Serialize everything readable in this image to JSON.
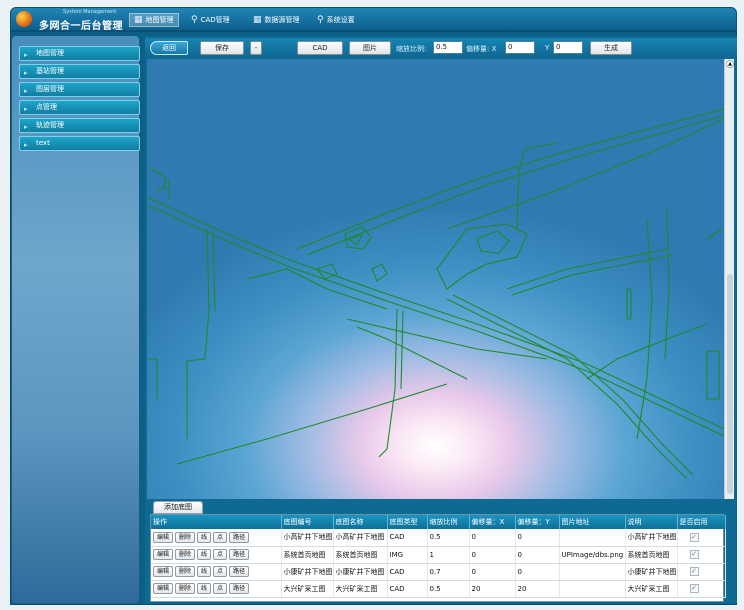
{
  "header": {
    "brand_sub": "System Management",
    "brand": "多网合一后台管理",
    "nav": [
      {
        "label": "地图管理",
        "icon": "grid-icon",
        "active": true
      },
      {
        "label": "CAD管理",
        "icon": "search-icon"
      },
      {
        "label": "数据源管理",
        "icon": "grid-icon"
      },
      {
        "label": "系统设置",
        "icon": "search-icon"
      }
    ]
  },
  "sidebar": {
    "items": [
      {
        "label": "地图管理"
      },
      {
        "label": "基站管理"
      },
      {
        "label": "图层管理"
      },
      {
        "label": "点管理"
      },
      {
        "label": "轨迹管理"
      },
      {
        "label": "text"
      }
    ]
  },
  "toolbar": {
    "back_label": "返回",
    "save_label": "保存",
    "minus_label": "-",
    "cad_label": "CAD",
    "image_label": "图片",
    "scale_label": "缩放比例:",
    "scale_value": "0.5",
    "offset_x_label": "偏移量: X",
    "offset_x_value": "0",
    "offset_y_label": "Y",
    "offset_y_value": "0",
    "generate_label": "生成"
  },
  "table": {
    "add_tab": "添加底图",
    "headers": [
      "操作",
      "底图编号",
      "底图名称",
      "底图类型",
      "缩放比例",
      "偏移量：X",
      "偏移量：Y",
      "图片地址",
      "说明",
      "是否启用"
    ],
    "actions": [
      "编辑",
      "删除",
      "线",
      "点",
      "路径"
    ],
    "rows": [
      {
        "code": "小高矿井下地图",
        "name": "小高矿井下地图",
        "type": "CAD",
        "scale": "0.5",
        "x": "0",
        "y": "0",
        "addr": "",
        "desc": "小高矿井下地图",
        "enabled": "✓"
      },
      {
        "code": "系统首页地图",
        "name": "系统首页地图",
        "type": "IMG",
        "scale": "1",
        "x": "0",
        "y": "0",
        "addr": "UPImage/dbs.png",
        "desc": "系统首页地图",
        "enabled": "✓"
      },
      {
        "code": "小康矿井下地图",
        "name": "小康矿井下地图",
        "type": "CAD",
        "scale": "0.7",
        "x": "0",
        "y": "0",
        "addr": "",
        "desc": "小康矿井下地图",
        "enabled": "✓"
      },
      {
        "code": "大兴矿采工图",
        "name": "大兴矿采工图",
        "type": "CAD",
        "scale": "0.5",
        "x": "20",
        "y": "20",
        "addr": "",
        "desc": "大兴矿采工图",
        "enabled": "✓"
      }
    ]
  },
  "colors": {
    "map_line": "#1f8a2c",
    "header": "#0e5f8c"
  }
}
